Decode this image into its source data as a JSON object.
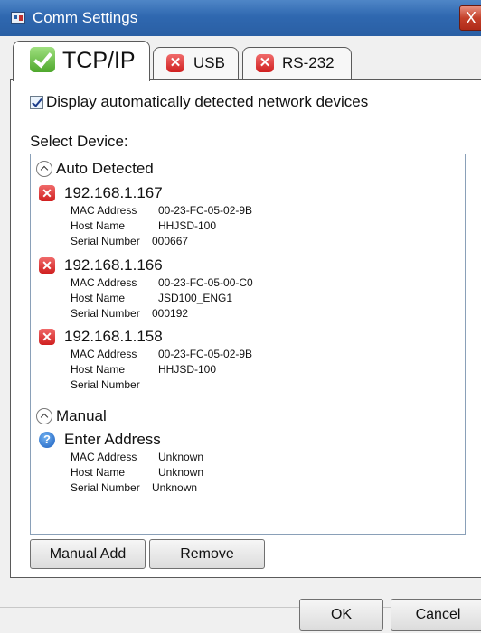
{
  "window": {
    "title": "Comm Settings",
    "close_glyph": "X"
  },
  "tabs": [
    {
      "label": "TCP/IP",
      "icon": "check-icon",
      "selected": true
    },
    {
      "label": "USB",
      "icon": "x-icon",
      "selected": false
    },
    {
      "label": "RS-232",
      "icon": "x-icon",
      "selected": false
    }
  ],
  "options": {
    "auto_detect_label": "Display automatically detected network devices",
    "auto_detect_checked": true
  },
  "select_device_label": "Select Device:",
  "groups": {
    "auto": {
      "label": "Auto Detected"
    },
    "manual": {
      "label": "Manual"
    }
  },
  "field_labels": {
    "mac": "MAC Address",
    "host": "Host Name",
    "serial": "Serial Number"
  },
  "devices": [
    {
      "ip": "192.168.1.167",
      "mac": "00-23-FC-05-02-9B",
      "host": "HHJSD-100",
      "serial": "000667",
      "status_icon": "x-icon"
    },
    {
      "ip": "192.168.1.166",
      "mac": "00-23-FC-05-00-C0",
      "host": "JSD100_ENG1",
      "serial": "000192",
      "status_icon": "x-icon"
    },
    {
      "ip": "192.168.1.158",
      "mac": "00-23-FC-05-02-9B",
      "host": "HHJSD-100",
      "serial": "",
      "status_icon": "x-icon"
    }
  ],
  "manual_entry": {
    "label": "Enter Address",
    "mac": "Unknown",
    "host": "Unknown",
    "serial": "Unknown",
    "status_icon": "question-icon"
  },
  "icon_glyphs": {
    "x": "✕",
    "question": "?"
  },
  "buttons": {
    "manual_add": "Manual Add",
    "remove": "Remove",
    "ok": "OK",
    "cancel": "Cancel"
  }
}
